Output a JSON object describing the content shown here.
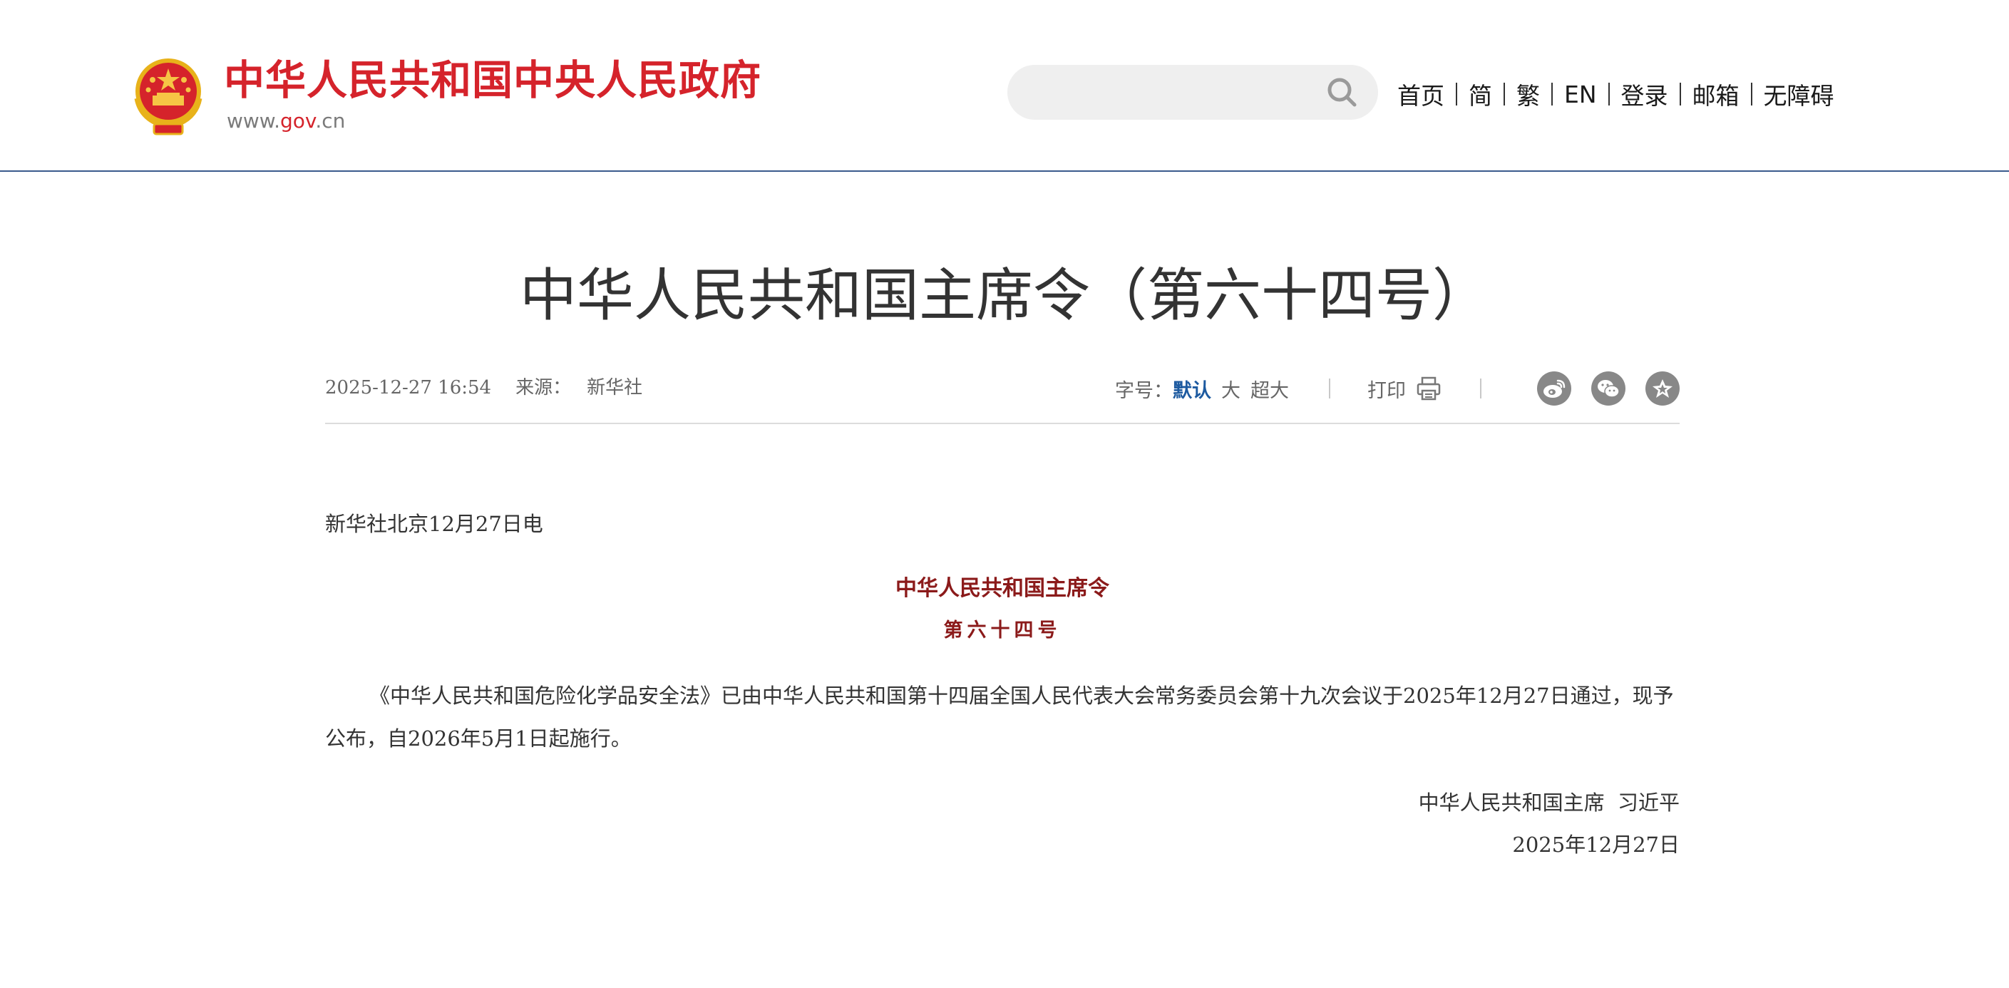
{
  "header": {
    "site_title": "中华人民共和国中央人民政府",
    "domain_prefix": "www.",
    "domain_highlight": "gov",
    "domain_suffix": ".cn",
    "search": {
      "placeholder": "",
      "value": ""
    },
    "nav": [
      {
        "label": "首页"
      },
      {
        "label": "简"
      },
      {
        "label": "繁"
      },
      {
        "label": "EN"
      },
      {
        "label": "登录"
      },
      {
        "label": "邮箱"
      },
      {
        "label": "无障碍"
      }
    ]
  },
  "article": {
    "title": "中华人民共和国主席令（第六十四号）",
    "date": "2025-12-27 16:54",
    "source_label": "来源：",
    "source": "新华社",
    "font_size_label": "字号：",
    "font_sizes": [
      {
        "label": "默认",
        "active": true
      },
      {
        "label": "大",
        "active": false
      },
      {
        "label": "超大",
        "active": false
      }
    ],
    "print_label": "打印",
    "share_icons": [
      "weibo-icon",
      "wechat-icon",
      "favorite-icon"
    ],
    "dateline": "新华社北京12月27日电",
    "order_title": "中华人民共和国主席令",
    "order_number": "第六十四号",
    "paragraph": "《中华人民共和国危险化学品安全法》已由中华人民共和国第十四届全国人民代表大会常务委员会第十九次会议于2025年12月27日通过，现予公布，自2026年5月1日起施行。",
    "signer": "中华人民共和国主席  习近平",
    "sign_date": "2025年12月27日"
  },
  "colors": {
    "brand_red": "#d5232b",
    "header_rule": "#3a5a8c",
    "active_link": "#1d5aa0",
    "order_red": "#8b1a1a",
    "share_gray": "#888888"
  }
}
